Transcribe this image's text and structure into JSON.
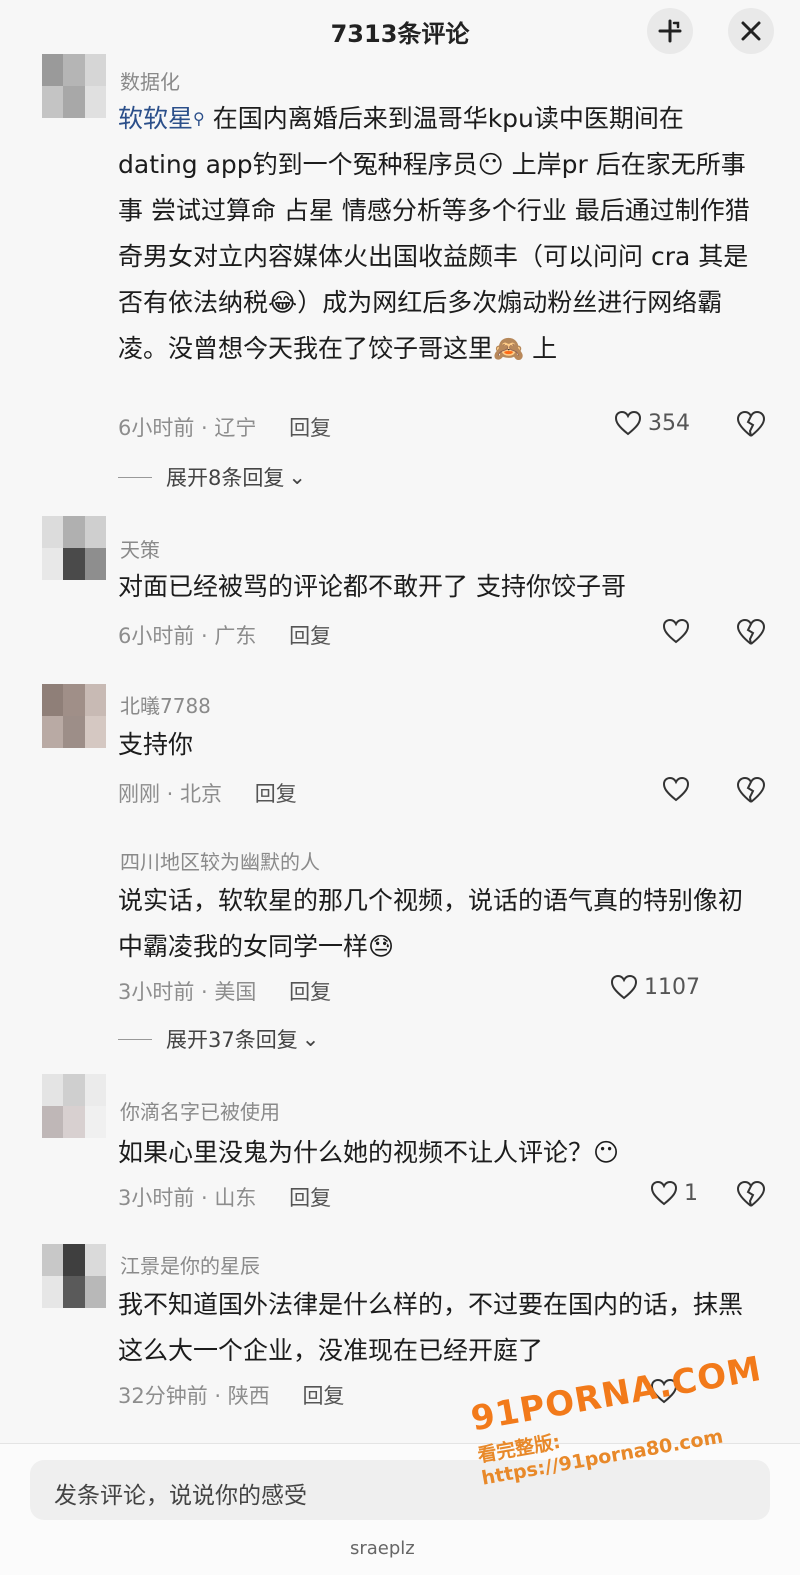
{
  "header": {
    "title": "7313条评论",
    "share_icon": "share-icon",
    "close_icon": "close-icon"
  },
  "comments": [
    {
      "username": "数据化",
      "mention": "软软星",
      "text": "在国内离婚后来到温哥华kpu读中医期间在dating app钓到一个冤种程序员😶 上岸pr 后在家无所事事 尝试过算命 占星 情感分析等多个行业 最后通过制作猎奇男女对立内容媒体火出国收益颇丰（可以问问 cra 其是否有依法纳税😂）成为网红后多次煽动粉丝进行网络霸凌。没曾想今天我在了饺子哥这里🙈 上",
      "time": "6小时前 · 辽宁",
      "reply": "回复",
      "likes": "354",
      "expand": "展开8条回复"
    },
    {
      "username": "天策",
      "text": "对面已经被骂的评论都不敢开了 支持你饺子哥",
      "time": "6小时前 · 广东",
      "reply": "回复",
      "likes": ""
    },
    {
      "username": "北㬢7788",
      "text": "支持你",
      "time": "刚刚 · 北京",
      "reply": "回复",
      "likes": ""
    },
    {
      "username": "四川地区较为幽默的人",
      "text": "说实话，软软星的那几个视频，说话的语气真的特别像初中霸凌我的女同学一样😓",
      "time": "3小时前 · 美国",
      "reply": "回复",
      "likes": "1107",
      "expand": "展开37条回复"
    },
    {
      "username": "你滴名字已被使用",
      "text": "如果心里没鬼为什么她的视频不让人评论？😶",
      "time": "3小时前 · 山东",
      "reply": "回复",
      "likes": "1"
    },
    {
      "username": "江景是你的星辰",
      "text": "我不知道国外法律是什么样的，不过要在国内的话，抹黑这么大一个企业，没准现在已经开庭了",
      "time": "32分钟前 · 陕西",
      "reply": "回复",
      "likes": ""
    }
  ],
  "footer": {
    "input_placeholder": "发条评论，说说你的感受",
    "faint_text": "sraeplz"
  },
  "watermark": {
    "logo": "91PORNA.COM",
    "url": "看完整版: https://91porna80.com"
  },
  "colors": {
    "mention": "#2b4f8a",
    "watermark": "#f27a1a"
  }
}
